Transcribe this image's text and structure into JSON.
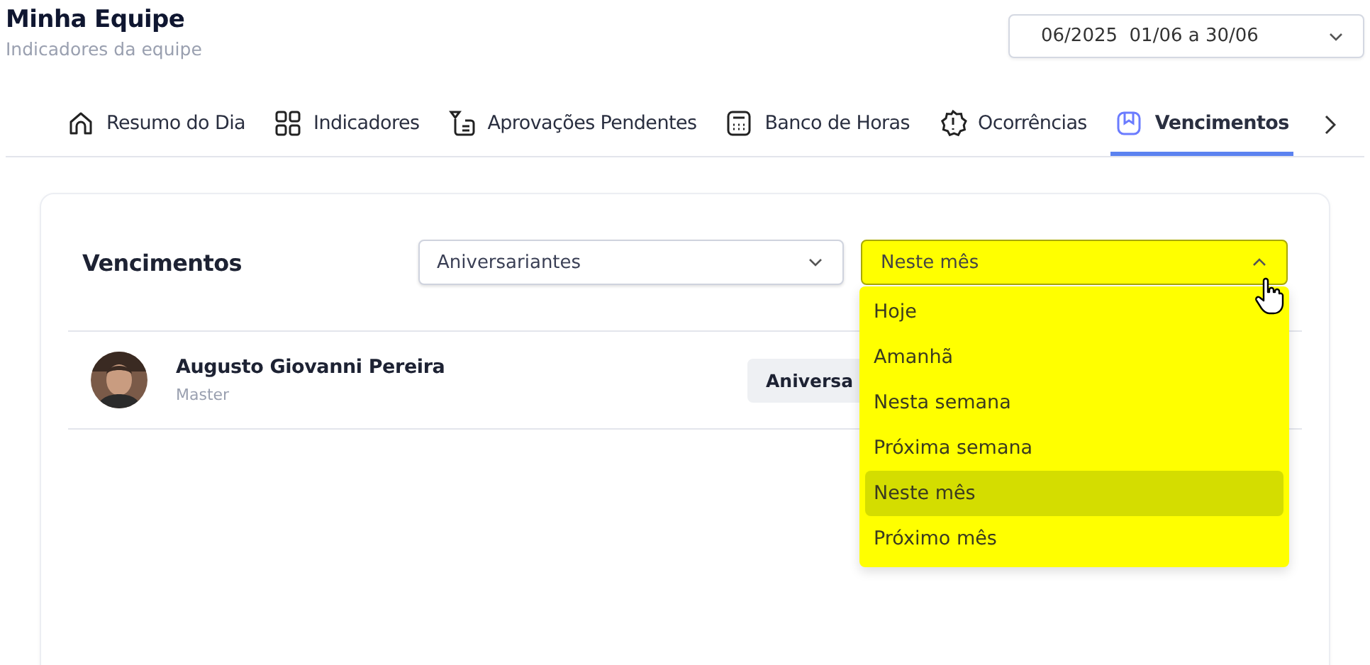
{
  "header": {
    "title": "Minha Equipe",
    "subtitle": "Indicadores da equipe",
    "period_select": "06/2025  01/06 a 30/06"
  },
  "tabs": [
    {
      "label": "Resumo do Dia",
      "kind": "home",
      "selected": false
    },
    {
      "label": "Indicadores",
      "kind": "grid",
      "selected": false
    },
    {
      "label": "Aprovações Pendentes",
      "kind": "approval",
      "selected": false
    },
    {
      "label": "Banco de Horas",
      "kind": "calculator",
      "selected": false
    },
    {
      "label": "Ocorrências",
      "kind": "alert",
      "selected": false
    },
    {
      "label": "Vencimentos",
      "kind": "bookmark",
      "selected": true
    }
  ],
  "card": {
    "title": "Vencimentos",
    "type_select": "Aniversariantes",
    "period_dropdown": {
      "value": "Neste mês",
      "expanded": true,
      "options": [
        {
          "label": "Hoje",
          "selected": false
        },
        {
          "label": "Amanhã",
          "selected": false
        },
        {
          "label": "Nesta semana",
          "selected": false
        },
        {
          "label": "Próxima semana",
          "selected": false
        },
        {
          "label": "Neste mês",
          "selected": true
        },
        {
          "label": "Próximo mês",
          "selected": false
        }
      ]
    },
    "rows": [
      {
        "name": "Augusto Giovanni Pereira",
        "role": "Master",
        "tag": "Aniversa"
      }
    ]
  }
}
